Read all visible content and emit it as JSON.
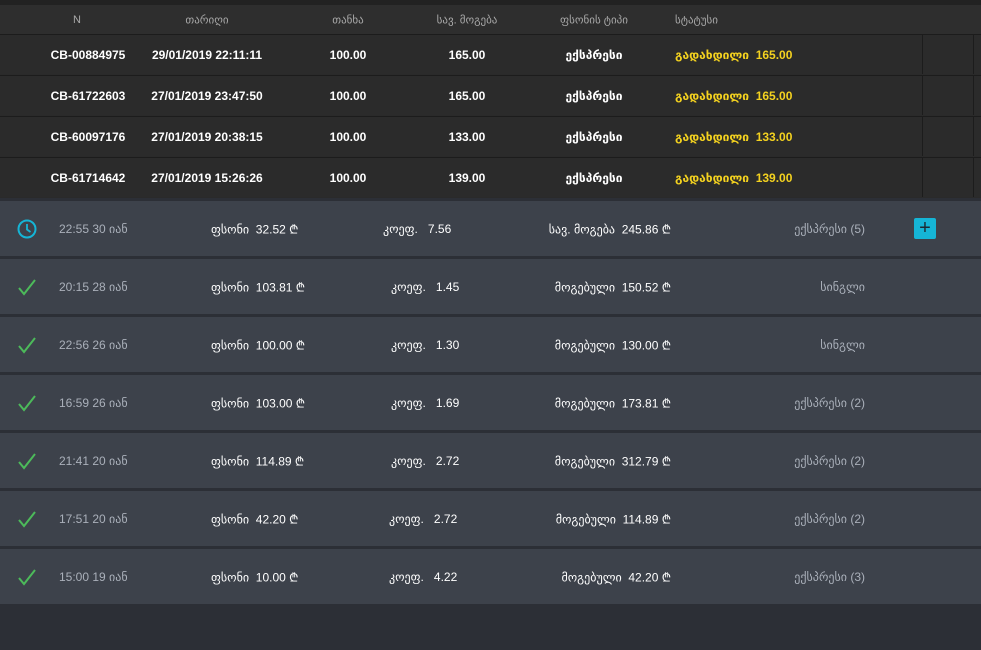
{
  "table": {
    "headers": [
      "N",
      "თარიღი",
      "თანხა",
      "სავ. მოგება",
      "ფსონის ტიპი",
      "სტატუსი"
    ],
    "rows": [
      {
        "id": "CB-00884975",
        "date": "29/01/2019 22:11:11",
        "amount": "100.00",
        "win": "165.00",
        "type": "ექსპრესი",
        "status": "გადახდილი",
        "status_amount": "165.00"
      },
      {
        "id": "CB-61722603",
        "date": "27/01/2019 23:47:50",
        "amount": "100.00",
        "win": "165.00",
        "type": "ექსპრესი",
        "status": "გადახდილი",
        "status_amount": "165.00"
      },
      {
        "id": "CB-60097176",
        "date": "27/01/2019 20:38:15",
        "amount": "100.00",
        "win": "133.00",
        "type": "ექსპრესი",
        "status": "გადახდილი",
        "status_amount": "133.00"
      },
      {
        "id": "CB-61714642",
        "date": "27/01/2019 15:26:26",
        "amount": "100.00",
        "win": "139.00",
        "type": "ექსპრესი",
        "status": "გადახდილი",
        "status_amount": "139.00"
      }
    ]
  },
  "colors": {
    "paid": "#f4d21f",
    "pending": "#15b5d6",
    "won": "#4cba5a"
  },
  "bets": [
    {
      "icon": "clock-icon",
      "time": "22:55 30 იან",
      "stake_label": "ფსონი",
      "stake": "32.52 ₾",
      "coef_label": "კოეფ.",
      "coef": "7.56",
      "win_label": "სავ. მოგება",
      "win": "245.86 ₾",
      "type": "ექსპრესი (5)",
      "plus": "+"
    },
    {
      "icon": "check-icon",
      "time": "20:15 28 იან",
      "stake_label": "ფსონი",
      "stake": "103.81 ₾",
      "coef_label": "კოეფ.",
      "coef": "1.45",
      "win_label": "მოგებული",
      "win": "150.52 ₾",
      "type": "სინგლი"
    },
    {
      "icon": "check-icon",
      "time": "22:56 26 იან",
      "stake_label": "ფსონი",
      "stake": "100.00 ₾",
      "coef_label": "კოეფ.",
      "coef": "1.30",
      "win_label": "მოგებული",
      "win": "130.00 ₾",
      "type": "სინგლი"
    },
    {
      "icon": "check-icon",
      "time": "16:59 26 იან",
      "stake_label": "ფსონი",
      "stake": "103.00 ₾",
      "coef_label": "კოეფ.",
      "coef": "1.69",
      "win_label": "მოგებული",
      "win": "173.81 ₾",
      "type": "ექსპრესი (2)"
    },
    {
      "icon": "check-icon",
      "time": "21:41 20 იან",
      "stake_label": "ფსონი",
      "stake": "114.89 ₾",
      "coef_label": "კოეფ.",
      "coef": "2.72",
      "win_label": "მოგებული",
      "win": "312.79 ₾",
      "type": "ექსპრესი (2)"
    },
    {
      "icon": "check-icon",
      "time": "17:51 20 იან",
      "stake_label": "ფსონი",
      "stake": "42.20 ₾",
      "coef_label": "კოეფ.",
      "coef": "2.72",
      "win_label": "მოგებული",
      "win": "114.89 ₾",
      "type": "ექსპრესი (2)"
    },
    {
      "icon": "check-icon",
      "time": "15:00 19 იან",
      "stake_label": "ფსონი",
      "stake": "10.00 ₾",
      "coef_label": "კოეფ.",
      "coef": "4.22",
      "win_label": "მოგებული",
      "win": "42.20 ₾",
      "type": "ექსპრესი (3)"
    }
  ]
}
